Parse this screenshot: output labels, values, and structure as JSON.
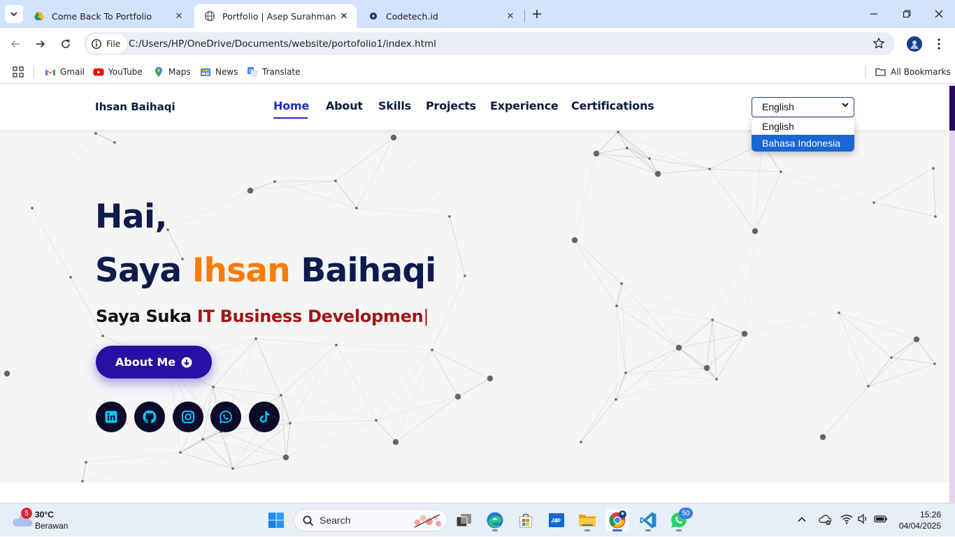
{
  "browser": {
    "tabs": [
      {
        "title": "Come Back To Portfolio",
        "active": false
      },
      {
        "title": "Portfolio | Asep Surahman Sulae",
        "active": true
      },
      {
        "title": "Codetech.id",
        "active": false
      }
    ],
    "address": {
      "chip_label": "File",
      "url": "C:/Users/HP/OneDrive/Documents/website/portofolio1/index.html"
    },
    "bookmarks": [
      "Gmail",
      "YouTube",
      "Maps",
      "News",
      "Translate"
    ],
    "all_bookmarks_label": "All Bookmarks"
  },
  "site": {
    "brand": "Ihsan Baihaqi",
    "nav": [
      "Home",
      "About",
      "Skills",
      "Projects",
      "Experience",
      "Certifications"
    ],
    "active_nav": "Home",
    "language_select": {
      "selected": "English",
      "options": [
        "English",
        "Bahasa Indonesia"
      ],
      "highlighted": "Bahasa Indonesia"
    },
    "hero": {
      "greeting": "Hai,",
      "intro_prefix": "Saya ",
      "name_first": "Ihsan",
      "name_last": " Baihaqi",
      "tagline_prefix": "Saya Suka ",
      "tagline_typed": "IT Business Developmen",
      "cursor": "|",
      "cta_label": "About Me"
    },
    "socials": [
      "linkedin-icon",
      "github-icon",
      "instagram-icon",
      "whatsapp-icon",
      "tiktok-icon"
    ],
    "colors": {
      "navy": "#0d1b4e",
      "orange": "#ff7a00",
      "red": "#a31515",
      "button": "#2a0fa5",
      "social_icon": "#00c8ff"
    }
  },
  "taskbar": {
    "weather": {
      "temp": "30°C",
      "desc": "Berawan",
      "badge": "5"
    },
    "search_label": "Search",
    "whatsapp_badge": "50",
    "time": "15:26",
    "date": "04/04/2025"
  }
}
